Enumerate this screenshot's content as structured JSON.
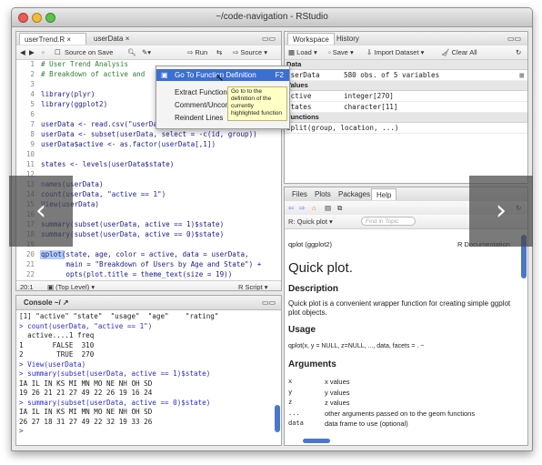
{
  "window": {
    "title": "~/code-navigation - RStudio"
  },
  "source": {
    "tabs": [
      "userTrend.R",
      "userData"
    ],
    "source_on_save": "Source on Save",
    "run": "Run",
    "source_btn": "Source",
    "lines": [
      {
        "n": "1",
        "t": "# User Trend Analysis",
        "c": true
      },
      {
        "n": "2",
        "t": "# Breakdown of active and",
        "c": true
      },
      {
        "n": "3",
        "t": ""
      },
      {
        "n": "4",
        "t": "library(plyr)"
      },
      {
        "n": "5",
        "t": "library(ggplot2)"
      },
      {
        "n": "6",
        "t": ""
      },
      {
        "n": "7",
        "t": "userData <- read.csv(\"userDataTrends.csv\")"
      },
      {
        "n": "8",
        "t": "userData <- subset(userData, select = -c(id, group))"
      },
      {
        "n": "9",
        "t": "userData$active <- as.factor(userData[,1])"
      },
      {
        "n": "10",
        "t": ""
      },
      {
        "n": "11",
        "t": "states <- levels(userData$state)"
      },
      {
        "n": "12",
        "t": ""
      },
      {
        "n": "13",
        "t": "names(userData)"
      },
      {
        "n": "14",
        "t": "count(userData, \"active == 1\")"
      },
      {
        "n": "15",
        "t": "View(userData)"
      },
      {
        "n": "16",
        "t": ""
      },
      {
        "n": "17",
        "t": "summary(subset(userData, active == 1)$state)"
      },
      {
        "n": "18",
        "t": "summary(subset(userData, active == 0)$state)"
      },
      {
        "n": "19",
        "t": ""
      },
      {
        "n": "20",
        "t": "qplot(state, age, color = active, data = userData,"
      },
      {
        "n": "21",
        "t": "      main = \"Breakdown of Users by Age and State\") +"
      },
      {
        "n": "22",
        "t": "      opts(plot.title = theme_text(size = 19))"
      }
    ],
    "status_pos": "20:1",
    "status_level": "(Top Level)",
    "status_lang": "R Script"
  },
  "context_menu": {
    "items": [
      {
        "label": "Go To Function Definition",
        "shortcut": "F2"
      },
      {
        "label": "Extract Function",
        "shortcut": ""
      },
      {
        "label": "Comment/Uncomment",
        "shortcut": ""
      },
      {
        "label": "Reindent Lines",
        "shortcut": ""
      }
    ],
    "tooltip": "Go to to the definition of the currently highlighted function"
  },
  "console": {
    "tab": "Console ~/",
    "lines": [
      "[1] \"active\" \"state\"  \"usage\"  \"age\"    \"rating\"",
      "> count(userData, \"active == 1\")",
      "  active....1 freq",
      "1       FALSE  310",
      "2        TRUE  270",
      "> View(userData)",
      "> summary(subset(userData, active == 1)$state)",
      "IA IL IN KS MI MN MO NE NH OH SD",
      "19 26 21 21 27 49 22 26 19 16 24",
      "> summary(subset(userData, active == 0)$state)",
      "IA IL IN KS MI MN MO NE NH OH SD",
      "26 27 18 31 27 49 22 32 19 33 26",
      ">"
    ]
  },
  "workspace": {
    "tabs": [
      "Workspace",
      "History"
    ],
    "load": "Load",
    "save": "Save",
    "import": "Import Dataset",
    "clear": "Clear All",
    "sections": {
      "data": "Data",
      "values": "Values",
      "functions": "Functions"
    },
    "data_rows": [
      {
        "name": "userData",
        "value": "580 obs. of 5 variables"
      }
    ],
    "value_rows": [
      {
        "name": "active",
        "value": "integer[270]"
      },
      {
        "name": "states",
        "value": "character[11]"
      }
    ],
    "function_rows": [
      {
        "name": "split(group, location, ...)",
        "value": ""
      }
    ]
  },
  "help": {
    "tabs": [
      "Files",
      "Plots",
      "Packages",
      "Help"
    ],
    "topic": "R: Quick plot",
    "find_placeholder": "Find in Topic",
    "header_left": "qplot (ggplot2)",
    "header_right": "R Documentation",
    "title": "Quick plot.",
    "description_h": "Description",
    "description": "Quick plot is a convenient wrapper function for creating simple ggplot plot objects.",
    "usage_h": "Usage",
    "usage": "qplot(x, y = NULL, z=NULL, ..., data, facets = . ~",
    "args_h": "Arguments",
    "args": [
      {
        "name": "x",
        "desc": "x values"
      },
      {
        "name": "y",
        "desc": "y values"
      },
      {
        "name": "z",
        "desc": "z values"
      },
      {
        "name": "...",
        "desc": "other arguments passed on to the geom functions"
      },
      {
        "name": "data",
        "desc": "data frame to use (optional)"
      }
    ]
  },
  "nav": {
    "prev": "‹",
    "next": "›"
  },
  "colors": {
    "selection": "#3b6fd4",
    "tooltip": "#ffffc6",
    "menu": "#f4f4f4"
  }
}
